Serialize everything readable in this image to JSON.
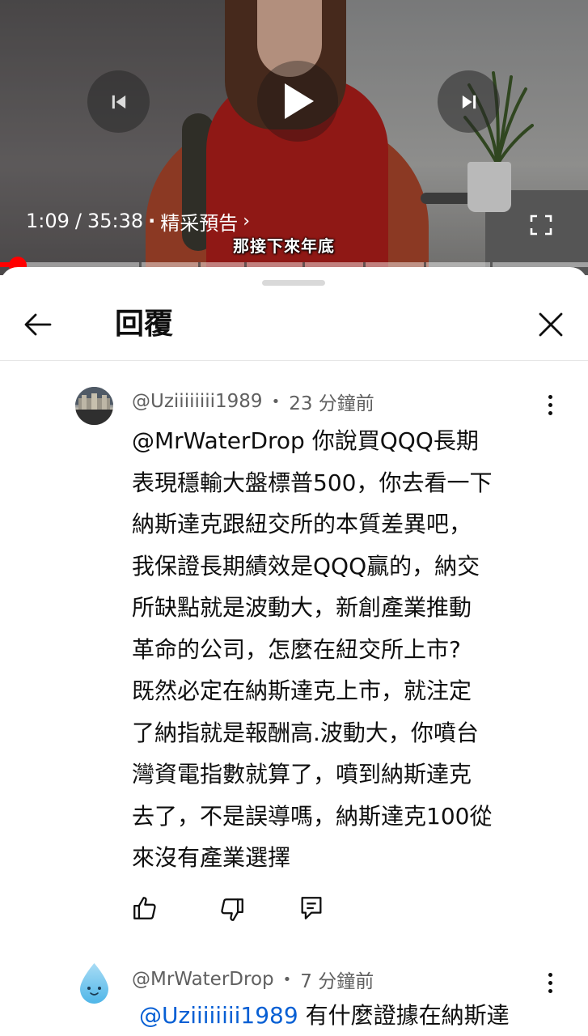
{
  "player": {
    "current_time": "1:09",
    "separator": "/",
    "duration": "35:38",
    "chapter_title": "精采預告",
    "subtitle": "那接下來年底",
    "progress_fraction": 0.03
  },
  "sheet": {
    "title": "回覆"
  },
  "comment": {
    "author": "@Uziiiiiiii1989",
    "time_ago": "23 分鐘前",
    "lines": [
      "@MrWaterDrop  你說買QQQ長期",
      "表現穩輸大盤標普500，你去看一下",
      "納斯達克跟紐交所的本質差異吧，",
      "我保證長期績效是QQQ贏的，納交",
      "所缺點就是波動大，新創產業推動",
      "革命的公司，怎麼在紐交所上市?",
      "既然必定在納斯達克上市，就注定",
      "了納指就是報酬高.波動大，你噴台",
      "灣資電指數就算了，噴到納斯達克",
      "去了，不是誤導嗎，納斯達克100從",
      "來沒有產業選擇"
    ]
  },
  "reply": {
    "author": "@MrWaterDrop",
    "time_ago": "7 分鐘前",
    "mention": "@Uziiiiiiii1989",
    "text": "有什麼證據在納斯達"
  },
  "icons": {
    "back": "arrow-left-icon",
    "close": "close-icon",
    "like": "thumbs-up-icon",
    "dislike": "thumbs-down-icon",
    "reply": "comment-icon",
    "more": "more-vertical-icon"
  },
  "colors": {
    "progress": "#ff0000",
    "mention": "#065fd4",
    "meta": "#606060"
  }
}
